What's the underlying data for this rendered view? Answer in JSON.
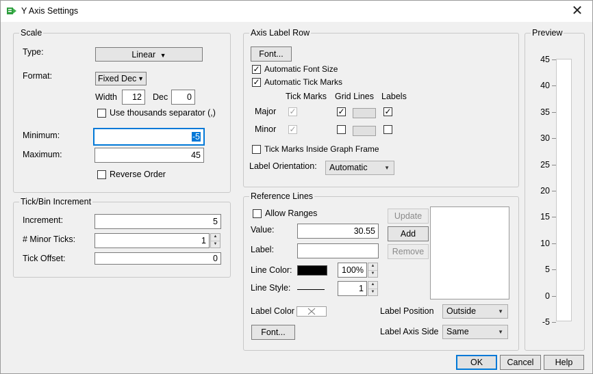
{
  "window": {
    "title": "Y Axis Settings",
    "close_glyph": "✕"
  },
  "scale": {
    "group_label": "Scale",
    "type_label": "Type:",
    "type_value": "Linear",
    "format_label": "Format:",
    "format_value": "Fixed Dec",
    "width_label": "Width",
    "width_value": "12",
    "dec_label": "Dec",
    "dec_value": "0",
    "thousands_label": "Use thousands separator (,)",
    "minimum_label": "Minimum:",
    "minimum_value": "-5",
    "maximum_label": "Maximum:",
    "maximum_value": "45",
    "reverse_label": "Reverse Order"
  },
  "tick_bin": {
    "group_label": "Tick/Bin Increment",
    "increment_label": "Increment:",
    "increment_value": "5",
    "minor_ticks_label": "# Minor Ticks:",
    "minor_ticks_value": "1",
    "tick_offset_label": "Tick Offset:",
    "tick_offset_value": "0"
  },
  "axis_label_row": {
    "group_label": "Axis Label Row",
    "font_button": "Font...",
    "auto_font_size_label": "Automatic Font Size",
    "auto_font_size_checked": true,
    "auto_tick_marks_label": "Automatic Tick Marks",
    "auto_tick_marks_checked": true,
    "col_tick_marks": "Tick Marks",
    "col_grid_lines": "Grid Lines",
    "col_labels": "Labels",
    "major_label": "Major",
    "minor_label": "Minor",
    "inside_frame_label": "Tick Marks Inside Graph Frame",
    "orientation_label": "Label Orientation:",
    "orientation_value": "Automatic"
  },
  "reference_lines": {
    "group_label": "Reference Lines",
    "allow_ranges_label": "Allow Ranges",
    "value_label": "Value:",
    "value_value": "30.55",
    "label_label": "Label:",
    "label_value": "",
    "line_color_label": "Line Color:",
    "line_color": "#000000",
    "opacity_value": "100%",
    "line_style_label": "Line Style:",
    "line_width_value": "1",
    "label_color_label": "Label Color",
    "label_position_label": "Label Position",
    "label_position_value": "Outside",
    "label_axis_side_label": "Label Axis Side",
    "label_axis_side_value": "Same",
    "font_button": "Font...",
    "update_button": "Update",
    "add_button": "Add",
    "remove_button": "Remove"
  },
  "preview": {
    "group_label": "Preview",
    "ticks": [
      "45",
      "40",
      "35",
      "30",
      "25",
      "20",
      "15",
      "10",
      "5",
      "0",
      "-5"
    ]
  },
  "footer": {
    "ok": "OK",
    "cancel": "Cancel",
    "help": "Help"
  },
  "colors": {
    "accent": "#0078d7",
    "title_icon": "#2e9e3e"
  }
}
